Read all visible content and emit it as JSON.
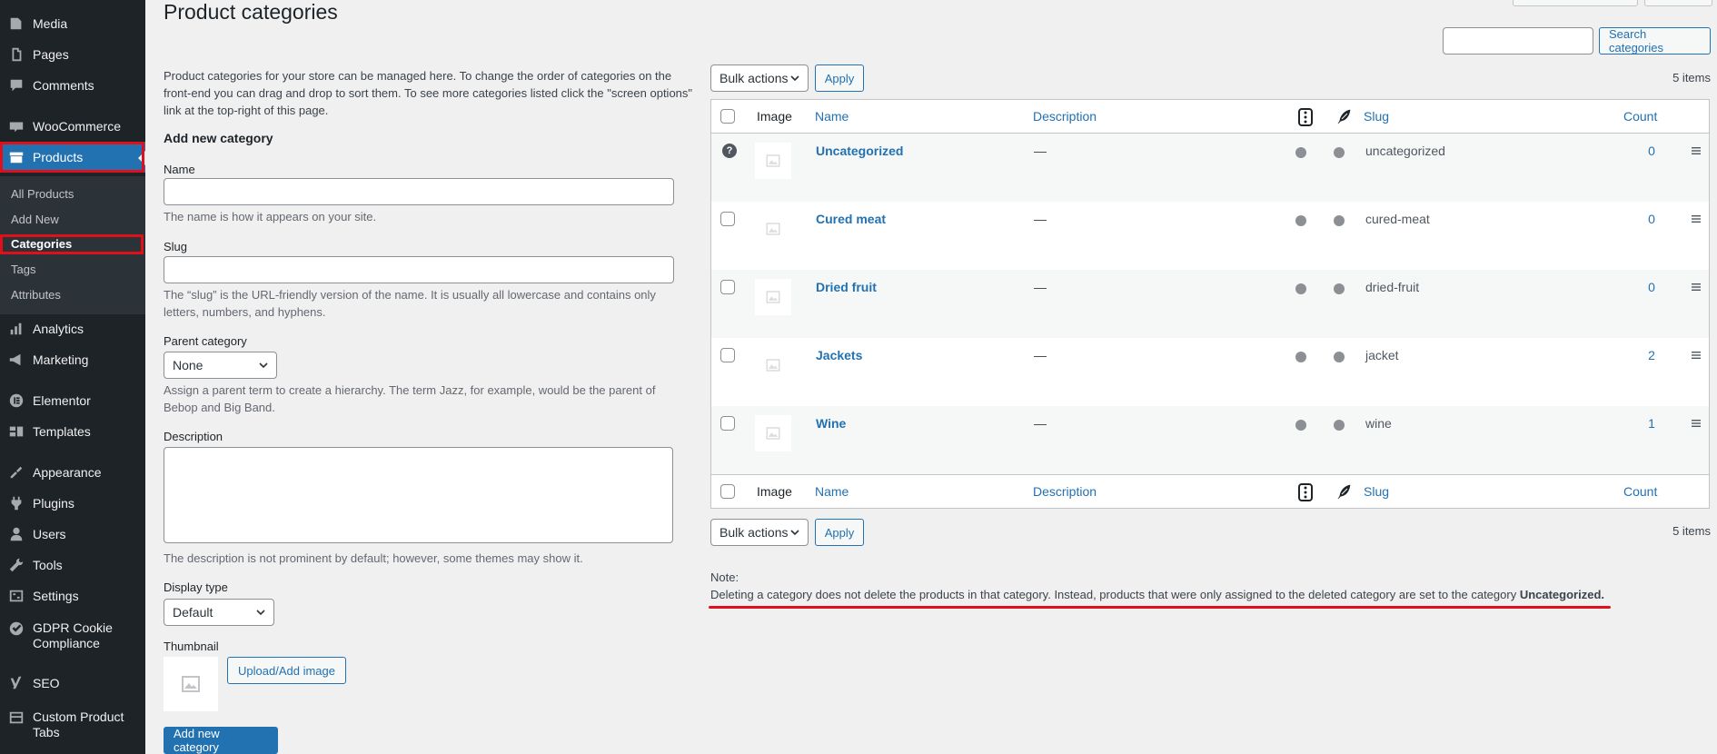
{
  "sidebar": {
    "items": [
      {
        "label": "Media",
        "icon": "media-icon"
      },
      {
        "label": "Pages",
        "icon": "pages-icon"
      },
      {
        "label": "Comments",
        "icon": "comments-icon"
      },
      {
        "label": "WooCommerce",
        "icon": "woocommerce-icon"
      },
      {
        "label": "Products",
        "icon": "products-icon"
      },
      {
        "label": "Analytics",
        "icon": "analytics-icon"
      },
      {
        "label": "Marketing",
        "icon": "marketing-icon"
      },
      {
        "label": "Elementor",
        "icon": "elementor-icon"
      },
      {
        "label": "Templates",
        "icon": "templates-icon"
      },
      {
        "label": "Appearance",
        "icon": "appearance-icon"
      },
      {
        "label": "Plugins",
        "icon": "plugins-icon"
      },
      {
        "label": "Users",
        "icon": "users-icon"
      },
      {
        "label": "Tools",
        "icon": "tools-icon"
      },
      {
        "label": "Settings",
        "icon": "settings-icon"
      },
      {
        "label": "GDPR Cookie Compliance",
        "icon": "gdpr-icon"
      },
      {
        "label": "SEO",
        "icon": "seo-icon"
      },
      {
        "label": "Custom Product Tabs",
        "icon": "tabs-icon"
      }
    ],
    "submenu": [
      "All Products",
      "Add New",
      "Categories",
      "Tags",
      "Attributes"
    ],
    "accent": "#2271b1",
    "background": "#1d2327",
    "highlight": "#e0101a"
  },
  "page": {
    "title": "Product categories",
    "intro": "Product categories for your store can be managed here. To change the order of categories on the front-end you can drag and drop to sort them. To see more categories listed click the \"screen options\" link at the top-right of this page."
  },
  "form": {
    "heading": "Add new category",
    "name_label": "Name",
    "name_value": "",
    "name_help": "The name is how it appears on your site.",
    "slug_label": "Slug",
    "slug_value": "",
    "slug_help": "The “slug” is the URL-friendly version of the name. It is usually all lowercase and contains only letters, numbers, and hyphens.",
    "parent_label": "Parent category",
    "parent_value": "None",
    "parent_help": "Assign a parent term to create a hierarchy. The term Jazz, for example, would be the parent of Bebop and Big Band.",
    "description_label": "Description",
    "description_help": "The description is not prominent by default; however, some themes may show it.",
    "display_label": "Display type",
    "display_value": "Default",
    "thumbnail_label": "Thumbnail",
    "upload_button": "Upload/Add image",
    "submit_button": "Add new category"
  },
  "list": {
    "search_button": "Search categories",
    "bulk_actions": "Bulk actions",
    "apply": "Apply",
    "items_count": "5 items",
    "columns": {
      "image": "Image",
      "name": "Name",
      "description": "Description",
      "slug": "Slug",
      "count": "Count"
    },
    "rows": [
      {
        "name": "Uncategorized",
        "description": "—",
        "slug": "uncategorized",
        "count": "0"
      },
      {
        "name": "Cured meat",
        "description": "—",
        "slug": "cured-meat",
        "count": "0"
      },
      {
        "name": "Dried fruit",
        "description": "—",
        "slug": "dried-fruit",
        "count": "0"
      },
      {
        "name": "Jackets",
        "description": "—",
        "slug": "jacket",
        "count": "2"
      },
      {
        "name": "Wine",
        "description": "—",
        "slug": "wine",
        "count": "1"
      }
    ]
  },
  "note": {
    "title": "Note:",
    "text": "Deleting a category does not delete the products in that category. Instead, products that were only assigned to the deleted category are set to the category ",
    "bold": "Uncategorized."
  }
}
